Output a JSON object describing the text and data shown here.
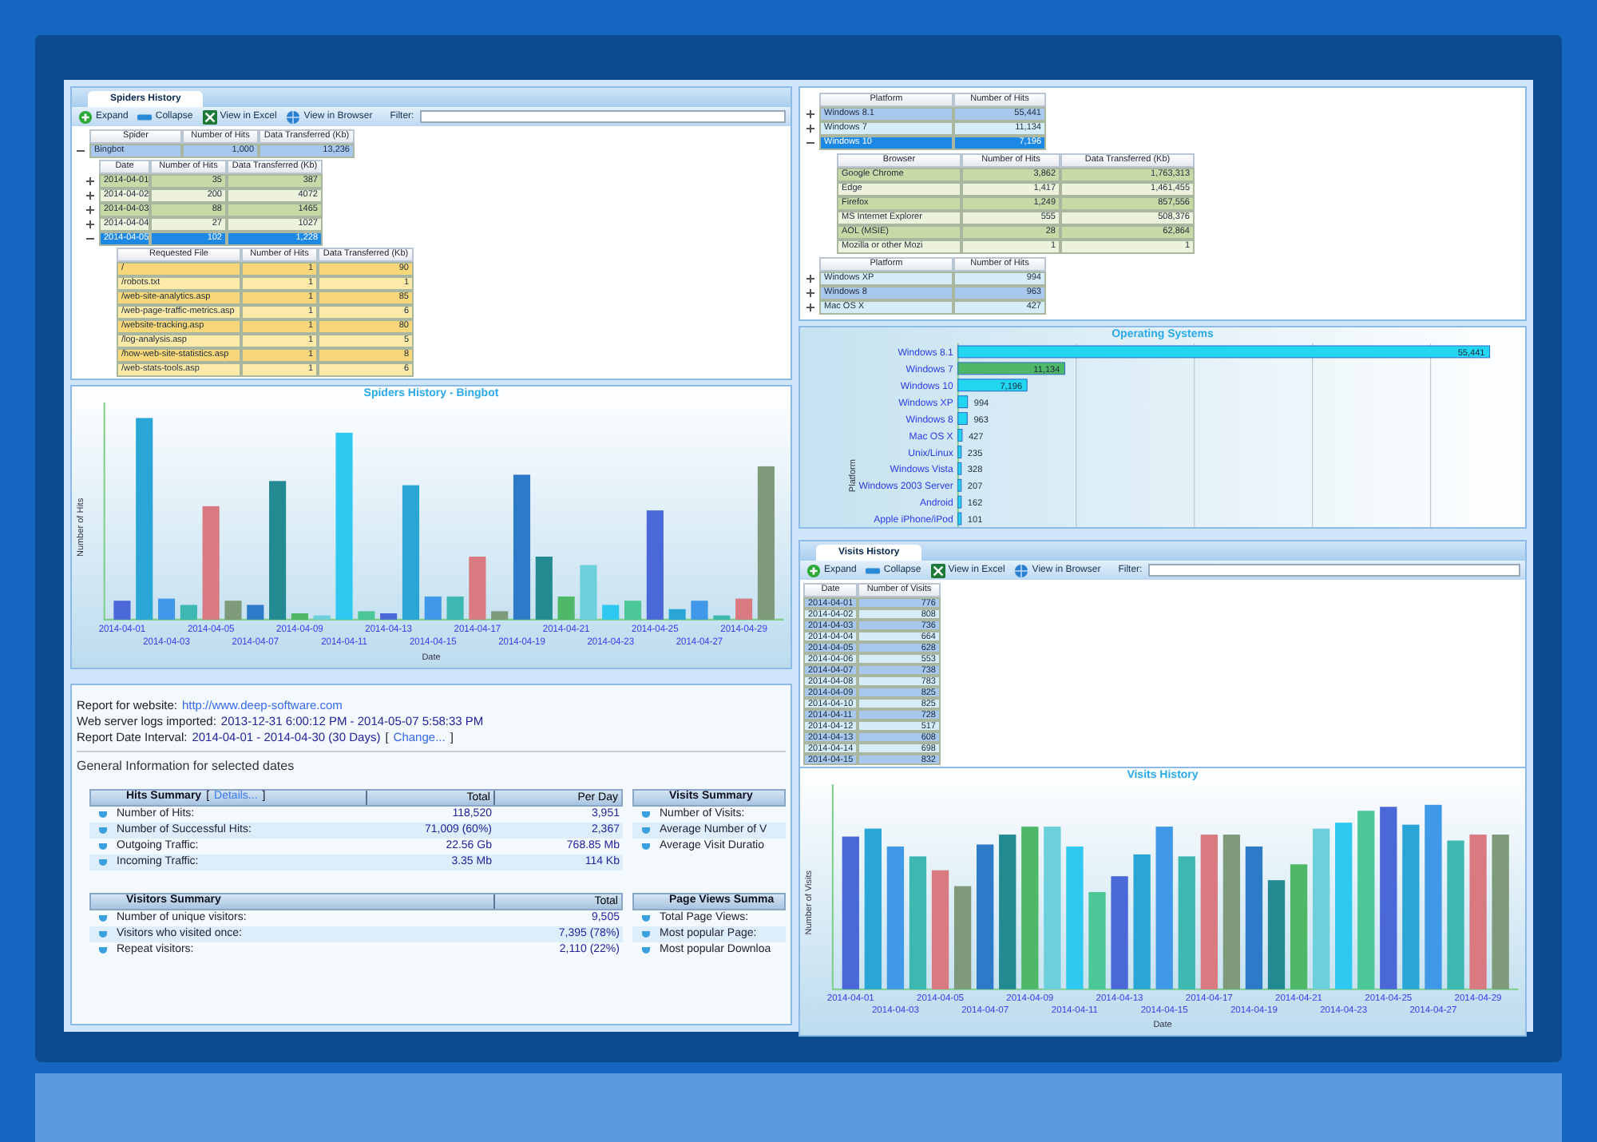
{
  "spiders_panel": {
    "tab": "Spiders History",
    "toolbar": [
      {
        "label": "Expand",
        "kind": "expand"
      },
      {
        "label": "Collapse",
        "kind": "collapse"
      },
      {
        "label": "View in Excel",
        "kind": "excel"
      },
      {
        "label": "View in Browser",
        "kind": "browser"
      }
    ],
    "filter": {
      "label": "Filter:"
    },
    "spider_table": {
      "columns": [
        "Spider",
        "Number of Hits",
        "Data Transferred (Kb)"
      ],
      "rows": [
        {
          "cells": [
            "Bingbot",
            "1,000",
            "13,236"
          ],
          "selected": false,
          "expanded": true
        }
      ]
    },
    "date_table": {
      "columns": [
        "Date",
        "Number of Hits",
        "Data Transferred (Kb)"
      ],
      "rows": [
        {
          "cells": [
            "2014-04-01",
            "35",
            "387"
          ],
          "selected": false,
          "expanded": false
        },
        {
          "cells": [
            "2014-04-02",
            "200",
            "4072"
          ],
          "selected": false,
          "expanded": false
        },
        {
          "cells": [
            "2014-04-03",
            "88",
            "1465"
          ],
          "selected": false,
          "expanded": false
        },
        {
          "cells": [
            "2014-04-04",
            "27",
            "1027"
          ],
          "selected": false,
          "expanded": false
        },
        {
          "cells": [
            "2014-04-05",
            "102",
            "1,228"
          ],
          "selected": true,
          "expanded": true
        }
      ]
    },
    "file_table": {
      "columns": [
        "Requested File",
        "Number of Hits",
        "Data Transferred (Kb)"
      ],
      "rows": [
        {
          "cells": [
            "/",
            "1",
            "90"
          ]
        },
        {
          "cells": [
            "/robots.txt",
            "1",
            "1"
          ]
        },
        {
          "cells": [
            "/web-site-analytics.asp",
            "1",
            "85"
          ]
        },
        {
          "cells": [
            "/web-page-traffic-metrics.asp",
            "1",
            "6"
          ]
        },
        {
          "cells": [
            "/website-tracking.asp",
            "1",
            "80"
          ]
        },
        {
          "cells": [
            "/log-analysis.asp",
            "1",
            "5"
          ]
        },
        {
          "cells": [
            "/how-web-site-statistics.asp",
            "1",
            "8"
          ]
        },
        {
          "cells": [
            "/web-stats-tools.asp",
            "1",
            "6"
          ]
        }
      ]
    }
  },
  "spider_chart": {
    "title": "Spiders History - Bingbot",
    "ylabel": "Number of Hits",
    "xlabel": "Date",
    "x_labels": [
      "2014-04-01",
      "2014-04-03",
      "2014-04-05",
      "2014-04-07",
      "2014-04-09",
      "2014-04-11",
      "2014-04-13",
      "2014-04-15",
      "2014-04-17",
      "2014-04-19",
      "2014-04-21",
      "2014-04-23",
      "2014-04-25",
      "2014-04-27",
      "2014-04-29"
    ]
  },
  "report": {
    "lines": [
      {
        "parts": [
          {
            "text": "Report for website:",
            "kind": "label"
          },
          {
            "text": "http://www.deep-software.com",
            "kind": "link"
          }
        ]
      },
      {
        "parts": [
          {
            "text": "Web server logs imported:",
            "kind": "label"
          },
          {
            "text": "2013-12-31 6:00:12 PM - 2014-05-07 5:58:33 PM",
            "kind": "value"
          }
        ]
      },
      {
        "parts": [
          {
            "text": "Report Date Interval:",
            "kind": "label"
          },
          {
            "text": "2014-04-01 - 2014-04-30 (30 Days)",
            "kind": "value"
          },
          {
            "text": "[",
            "kind": "label"
          },
          {
            "text": "Change...",
            "kind": "link"
          },
          {
            "text": "]",
            "kind": "label"
          }
        ]
      }
    ],
    "heading": "General Information for selected dates",
    "summaries": [
      {
        "title": "Hits Summary",
        "link_open": "[",
        "link": "Details...",
        "link_close": "]",
        "columns": [
          "Total",
          "Per Day"
        ],
        "rows": [
          {
            "label": "Number of Hits:",
            "values": [
              "118,520",
              "3,951"
            ]
          },
          {
            "label": "Number of Successful Hits:",
            "values": [
              "71,009 (60%)",
              "2,367"
            ]
          },
          {
            "label": "Outgoing Traffic:",
            "values": [
              "22.56 Gb",
              "768.85 Mb"
            ]
          },
          {
            "label": "Incoming Traffic:",
            "values": [
              "3.35 Mb",
              "114 Kb"
            ]
          }
        ]
      },
      {
        "title": "Visits Summary",
        "rows": [
          {
            "label": "Number of Visits:",
            "values": []
          },
          {
            "label": "Average Number of V",
            "values": []
          },
          {
            "label": "Average Visit Duratio",
            "values": []
          }
        ]
      },
      {
        "title": "Visitors Summary",
        "columns": [
          "Total"
        ],
        "rows": [
          {
            "label": "Number of unique visitors:",
            "values": [
              "9,505"
            ]
          },
          {
            "label": "Visitors who visited once:",
            "values": [
              "7,395 (78%)"
            ]
          },
          {
            "label": "Repeat visitors:",
            "values": [
              "2,110 (22%)"
            ]
          }
        ]
      },
      {
        "title": "Page Views Summa",
        "rows": [
          {
            "label": "Total Page Views:",
            "values": []
          },
          {
            "label": "Most popular Page:",
            "values": []
          },
          {
            "label": "Most popular Downloa",
            "values": []
          }
        ]
      }
    ]
  },
  "platform_panel": {
    "platform_table": {
      "columns": [
        "Platform",
        "Number of Hits"
      ],
      "rows": [
        {
          "cells": [
            "Windows 8.1",
            "55,441"
          ],
          "selected": false,
          "expanded": false
        },
        {
          "cells": [
            "Windows 7",
            "11,134"
          ],
          "selected": false,
          "expanded": false
        },
        {
          "cells": [
            "Windows 10",
            "7,196"
          ],
          "selected": true,
          "expanded": true
        }
      ]
    },
    "browser_table": {
      "columns": [
        "Browser",
        "Number of Hits",
        "Data Transferred (Kb)"
      ],
      "rows": [
        {
          "cells": [
            "Google Chrome",
            "3,862",
            "1,763,313"
          ]
        },
        {
          "cells": [
            "Edge",
            "1,417",
            "1,461,455"
          ]
        },
        {
          "cells": [
            "Firefox",
            "1,249",
            "857,556"
          ]
        },
        {
          "cells": [
            "MS Internet Explorer",
            "555",
            "508,376"
          ]
        },
        {
          "cells": [
            "AOL (MSIE)",
            "28",
            "62,864"
          ]
        },
        {
          "cells": [
            "Mozilla or other Mozi",
            "1",
            "1"
          ]
        }
      ]
    },
    "platform_table_2": {
      "columns": [
        "Platform",
        "Number of Hits"
      ],
      "rows": [
        {
          "cells": [
            "Windows XP",
            "994"
          ],
          "selected": false,
          "expanded": false
        },
        {
          "cells": [
            "Windows 8",
            "963"
          ],
          "selected": false,
          "expanded": false
        },
        {
          "cells": [
            "Mac OS X",
            "427"
          ],
          "selected": false,
          "expanded": false
        }
      ]
    }
  },
  "os_chart": {
    "chart_data": {
      "type": "bar",
      "orientation": "horizontal",
      "title": "Operating Systems",
      "ylabel": "Platform",
      "categories": [
        "Windows 8.1",
        "Windows 7",
        "Windows 10",
        "Windows XP",
        "Windows 8",
        "Mac OS X",
        "Unix/Linux",
        "Windows Vista",
        "Windows 2003 Server",
        "Android",
        "Apple iPhone/iPod"
      ],
      "values": [
        55441,
        11134,
        7196,
        994,
        963,
        427,
        235,
        328,
        207,
        162,
        101
      ],
      "value_labels": [
        "55,441",
        "11,134",
        "7,196",
        "994",
        "963",
        "427",
        "235",
        "328",
        "207",
        "162",
        "101"
      ]
    }
  },
  "visits_panel": {
    "tab": "Visits History",
    "toolbar": [
      {
        "label": "Expand",
        "kind": "expand"
      },
      {
        "label": "Collapse",
        "kind": "collapse"
      },
      {
        "label": "View in Excel",
        "kind": "excel"
      },
      {
        "label": "View in Browser",
        "kind": "browser"
      }
    ],
    "filter": {
      "label": "Filter:"
    },
    "table": {
      "columns": [
        "Date",
        "Number of Visits"
      ],
      "rows": [
        {
          "cells": [
            "2014-04-01",
            "776"
          ]
        },
        {
          "cells": [
            "2014-04-02",
            "808"
          ]
        },
        {
          "cells": [
            "2014-04-03",
            "736"
          ]
        },
        {
          "cells": [
            "2014-04-04",
            "664"
          ]
        },
        {
          "cells": [
            "2014-04-05",
            "628"
          ]
        },
        {
          "cells": [
            "2014-04-06",
            "553"
          ]
        },
        {
          "cells": [
            "2014-04-07",
            "738"
          ]
        },
        {
          "cells": [
            "2014-04-08",
            "783"
          ]
        },
        {
          "cells": [
            "2014-04-09",
            "825"
          ]
        },
        {
          "cells": [
            "2014-04-10",
            "825"
          ]
        },
        {
          "cells": [
            "2014-04-11",
            "728"
          ]
        },
        {
          "cells": [
            "2014-04-12",
            "517"
          ]
        },
        {
          "cells": [
            "2014-04-13",
            "608"
          ]
        },
        {
          "cells": [
            "2014-04-14",
            "698"
          ]
        },
        {
          "cells": [
            "2014-04-15",
            "832"
          ]
        }
      ]
    }
  },
  "visits_chart": {
    "title": "Visits History",
    "ylabel": "Number of Visits",
    "xlabel": "Date",
    "x_labels": [
      "2014-04-01",
      "2014-04-03",
      "2014-04-05",
      "2014-04-07",
      "2014-04-09",
      "2014-04-11",
      "2014-04-13",
      "2014-04-15",
      "2014-04-17",
      "2014-04-19",
      "2014-04-21",
      "2014-04-23",
      "2014-04-25",
      "2014-04-27",
      "2014-04-29"
    ]
  }
}
